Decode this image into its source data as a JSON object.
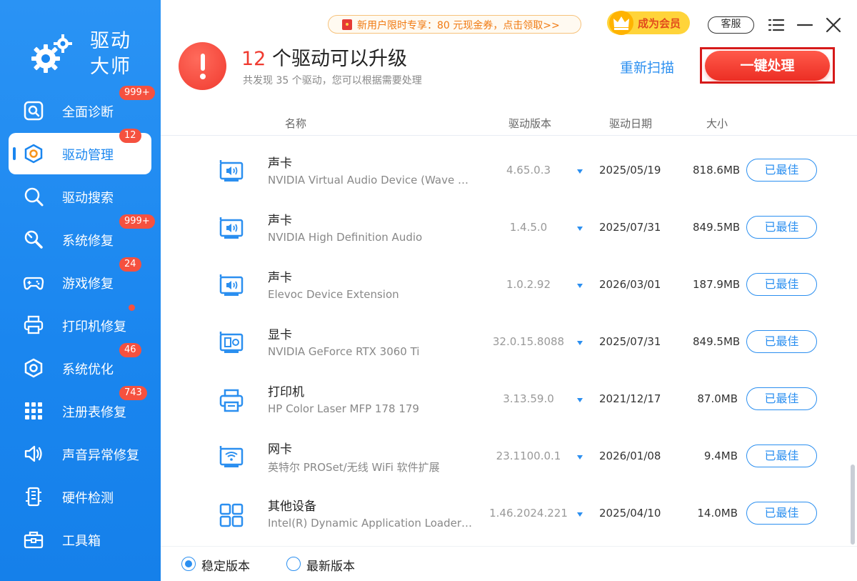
{
  "app": {
    "name_line1": "驱动",
    "name_line2": "大师"
  },
  "sidebar": {
    "items": [
      {
        "label": "全面诊断",
        "badge": "999+",
        "icon": "diagnose-icon"
      },
      {
        "label": "驱动管理",
        "badge": "12",
        "icon": "hexagon-icon",
        "active": true
      },
      {
        "label": "驱动搜索",
        "badge": "",
        "icon": "search-icon"
      },
      {
        "label": "系统修复",
        "badge": "999+",
        "icon": "wrench-icon"
      },
      {
        "label": "游戏修复",
        "badge": "24",
        "icon": "gamepad-icon"
      },
      {
        "label": "打印机修复",
        "badge": "",
        "dot": true,
        "icon": "printer-icon"
      },
      {
        "label": "系统优化",
        "badge": "46",
        "icon": "optimize-icon"
      },
      {
        "label": "注册表修复",
        "badge": "743",
        "icon": "grid-icon"
      },
      {
        "label": "声音异常修复",
        "badge": "",
        "icon": "speaker-icon"
      },
      {
        "label": "硬件检测",
        "badge": "",
        "icon": "hardware-icon"
      },
      {
        "label": "工具箱",
        "badge": "",
        "icon": "toolbox-icon"
      }
    ]
  },
  "topbar": {
    "promo": "新用户限时专享：80 元现金券，点击领取>>",
    "vip": "成为会员",
    "service": "客服"
  },
  "header": {
    "count": "12",
    "title_rest": " 个驱动可以升级",
    "subtitle": "共发现 35 个驱动，您可以根据需要处理",
    "rescan": "重新扫描",
    "onekey": "一键处理"
  },
  "table": {
    "columns": {
      "name": "名称",
      "version": "驱动版本",
      "date": "驱动日期",
      "size": "大小"
    },
    "rows": [
      {
        "category": "声卡",
        "name": "NVIDIA Virtual Audio Device (Wave Ex...",
        "version": "4.65.0.3",
        "date": "2025/05/19",
        "size": "818.6MB",
        "status": "已最佳",
        "icon": "sound-card-icon"
      },
      {
        "category": "声卡",
        "name": "NVIDIA High Definition Audio",
        "version": "1.4.5.0",
        "date": "2025/07/31",
        "size": "849.5MB",
        "status": "已最佳",
        "icon": "sound-card-icon"
      },
      {
        "category": "声卡",
        "name": "Elevoc Device Extension",
        "version": "1.0.2.92",
        "date": "2026/03/01",
        "size": "187.9MB",
        "status": "已最佳",
        "icon": "sound-card-icon"
      },
      {
        "category": "显卡",
        "name": "NVIDIA GeForce RTX 3060 Ti",
        "version": "32.0.15.8088",
        "date": "2025/07/31",
        "size": "849.5MB",
        "status": "已最佳",
        "icon": "graphics-card-icon"
      },
      {
        "category": "打印机",
        "name": "HP Color Laser MFP 178 179",
        "version": "3.13.59.0",
        "date": "2021/12/17",
        "size": "87.0MB",
        "status": "已最佳",
        "icon": "printer-icon"
      },
      {
        "category": "网卡",
        "name": "英特尔 PROSet/无线 WiFi 软件扩展",
        "version": "23.1100.0.1",
        "date": "2026/01/08",
        "size": "9.4MB",
        "status": "已最佳",
        "icon": "network-card-icon"
      },
      {
        "category": "其他设备",
        "name": "Intel(R) Dynamic Application Loader H...",
        "version": "1.46.2024.221",
        "date": "2025/04/10",
        "size": "14.0MB",
        "status": "已最佳",
        "icon": "other-device-icon"
      }
    ]
  },
  "footer": {
    "stable": "稳定版本",
    "latest": "最新版本",
    "selected": "stable"
  },
  "colors": {
    "sidebar": "#1a86ef",
    "accent": "#2b8ff0",
    "danger": "#f03a2f",
    "badge": "#f5513f"
  }
}
